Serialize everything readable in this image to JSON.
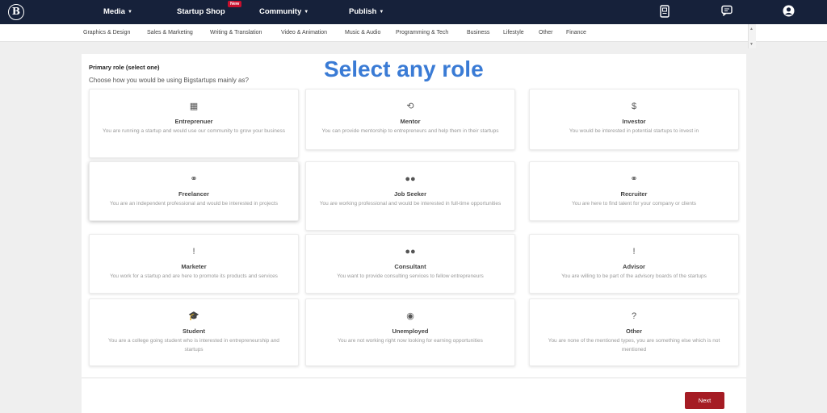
{
  "logo": {
    "letter": "B"
  },
  "nav": {
    "items": [
      {
        "label": "Media",
        "caret": "▼"
      },
      {
        "label": "Startup Shop",
        "caret": ""
      },
      {
        "label": "Community",
        "caret": "▼"
      },
      {
        "label": "Publish",
        "caret": "▼"
      }
    ],
    "new_badge": "New"
  },
  "top_icons": [
    "notes-icon",
    "chat-icon",
    "user-avatar-icon"
  ],
  "categories": [
    "Graphics & Design",
    "Sales & Marketing",
    "Writing & Translation",
    "Video & Animation",
    "Music & Audio",
    "Programming & Tech",
    "Business",
    "Lifestyle",
    "Other",
    "Finance"
  ],
  "form": {
    "title": "Primary role (select one)",
    "subtitle": "Choose how you would be using Bigstartups mainly as?",
    "overlay_title": "Select any role",
    "next_label": "Next"
  },
  "roles": [
    {
      "icon": "building-icon",
      "glyph": "▦",
      "title": "Entreprenuer",
      "desc": "You are running a startup and would use our community to grow your business"
    },
    {
      "icon": "handshake-icon",
      "glyph": "⟲",
      "title": "Mentor",
      "desc": "You can provide mentorship to entrepreneurs and help them in their startups"
    },
    {
      "icon": "dollar-icon",
      "glyph": "$",
      "title": "Investor",
      "desc": "You would be interested in potential startups to invest in"
    },
    {
      "icon": "handshake-icon",
      "glyph": "⚭",
      "title": "Freelancer",
      "desc": "You are an independent professional and would be interested in projects"
    },
    {
      "icon": "users-icon",
      "glyph": "●●",
      "title": "Job Seeker",
      "desc": "You are working professional and would be interested in full-time opportunities"
    },
    {
      "icon": "handshake-icon",
      "glyph": "⚭",
      "title": "Recruiter",
      "desc": "You are here to find talent for your company or clients"
    },
    {
      "icon": "exclamation-icon",
      "glyph": "!",
      "title": "Marketer",
      "desc": "You work for a startup and are here to promote its products and services"
    },
    {
      "icon": "users-icon",
      "glyph": "●●",
      "title": "Consultant",
      "desc": "You want to provide consulting services to fellow entrepreneurs"
    },
    {
      "icon": "exclamation-icon",
      "glyph": "!",
      "title": "Advisor",
      "desc": "You are willing to be part of the advisory boards of the startups"
    },
    {
      "icon": "graduation-cap-icon",
      "glyph": "🎓",
      "title": "Student",
      "desc": "You are a college going student who is interested in entrepreneurship and startups"
    },
    {
      "icon": "user-secret-icon",
      "glyph": "◉",
      "title": "Unemployed",
      "desc": "You are not working right now looking for earning opportunities"
    },
    {
      "icon": "question-icon",
      "glyph": "?",
      "title": "Other",
      "desc": "You are none of the mentioned types, you are something else which is not mentioned"
    }
  ],
  "colors": {
    "navbar": "#16213a",
    "accent": "#3a7bd5",
    "button": "#a51c24",
    "badge": "#c8102e"
  }
}
